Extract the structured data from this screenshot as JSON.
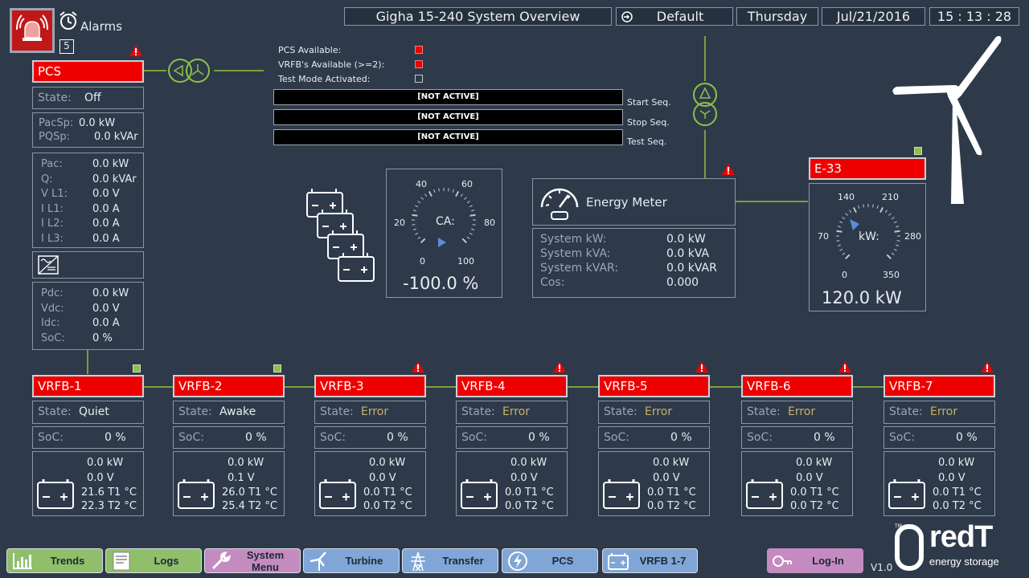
{
  "header": {
    "alarms_label": "Alarms",
    "alarm_count": "5",
    "title": "Gigha 15-240 System Overview",
    "profile": "Default",
    "day": "Thursday",
    "date": "Jul/21/2016",
    "time": "15 : 13 : 28"
  },
  "pcs": {
    "name": "PCS",
    "state_label": "State:",
    "state": "Off",
    "pacsp_label": "PacSp:",
    "pacsp": "0.0  kW",
    "pqsp_label": "PQSp:",
    "pqsp": "0.0  kVAr",
    "ac": [
      {
        "label": "Pac:",
        "value": "0.0  kW"
      },
      {
        "label": "Q:",
        "value": "0.0  kVAr"
      },
      {
        "label": "V L1:",
        "value": "0.0  V"
      },
      {
        "label": "I L1:",
        "value": "0.0  A"
      },
      {
        "label": "I L2:",
        "value": "0.0  A"
      },
      {
        "label": "I L3:",
        "value": "0.0  A"
      }
    ],
    "dc": [
      {
        "label": "Pdc:",
        "value": "0.0  kW"
      },
      {
        "label": "Vdc:",
        "value": "0.0  V"
      },
      {
        "label": "Idc:",
        "value": "0.0  A"
      },
      {
        "label": "SoC:",
        "value": "0  %"
      }
    ]
  },
  "status": {
    "pcs_available": "PCS Available:",
    "vrfb_available": "VRFB's Available (>=2):",
    "test_mode": "Test Mode Activated:",
    "colors": {
      "active": "#ee0000",
      "inactive": "#2e3a4a"
    }
  },
  "sequences": [
    {
      "status": "[NOT ACTIVE]",
      "label": "Start Seq."
    },
    {
      "status": "[NOT ACTIVE]",
      "label": "Stop Seq."
    },
    {
      "status": "[NOT ACTIVE]",
      "label": "Test Seq."
    }
  ],
  "ca_gauge": {
    "label": "CA:",
    "ticks": [
      "0",
      "20",
      "40",
      "60",
      "80",
      "100"
    ],
    "value": "-100.0  %"
  },
  "energy_meter": {
    "title": "Energy Meter",
    "rows": [
      {
        "label": "System kW:",
        "value": "0.0  kW"
      },
      {
        "label": "System kVA:",
        "value": "0.0  kVA"
      },
      {
        "label": "System kVAR:",
        "value": "0.0  kVAR"
      },
      {
        "label": "Cos:",
        "value": "0.000"
      }
    ]
  },
  "turbine": {
    "name": "E-33",
    "gauge_label": "kW:",
    "ticks": [
      "0",
      "70",
      "140",
      "210",
      "280",
      "350"
    ],
    "value": "120.0  kW"
  },
  "vrfbs": [
    {
      "name": "VRFB-1",
      "state": "Quiet",
      "error": false,
      "soc": "0  %",
      "kw": "0.0  kW",
      "v": "0.0  V",
      "t1": "21.6  T1 °C",
      "t2": "22.3  T2 °C",
      "indicator": "ok"
    },
    {
      "name": "VRFB-2",
      "state": "Awake",
      "error": false,
      "soc": "0  %",
      "kw": "0.0  kW",
      "v": "0.1  V",
      "t1": "26.0  T1 °C",
      "t2": "25.4  T2 °C",
      "indicator": "ok"
    },
    {
      "name": "VRFB-3",
      "state": "Error",
      "error": true,
      "soc": "0  %",
      "kw": "0.0  kW",
      "v": "0.0  V",
      "t1": "0.0  T1 °C",
      "t2": "0.0  T2 °C",
      "indicator": "warn"
    },
    {
      "name": "VRFB-4",
      "state": "Error",
      "error": true,
      "soc": "0  %",
      "kw": "0.0  kW",
      "v": "0.0  V",
      "t1": "0.0  T1 °C",
      "t2": "0.0  T2 °C",
      "indicator": "warn"
    },
    {
      "name": "VRFB-5",
      "state": "Error",
      "error": true,
      "soc": "0  %",
      "kw": "0.0  kW",
      "v": "0.0  V",
      "t1": "0.0  T1 °C",
      "t2": "0.0  T2 °C",
      "indicator": "warn"
    },
    {
      "name": "VRFB-6",
      "state": "Error",
      "error": true,
      "soc": "0  %",
      "kw": "0.0  kW",
      "v": "0.0  V",
      "t1": "0.0  T1 °C",
      "t2": "0.0  T2 °C",
      "indicator": "warn"
    },
    {
      "name": "VRFB-7",
      "state": "Error",
      "error": true,
      "soc": "0  %",
      "kw": "0.0  kW",
      "v": "0.0  V",
      "t1": "0.0  T1 °C",
      "t2": "0.0  T2 °C",
      "indicator": "warn"
    }
  ],
  "vrfb_labels": {
    "state": "State:",
    "soc": "SoC:"
  },
  "nav": [
    {
      "label": "Trends",
      "icon": "chart-icon",
      "color": "#8fbf6a"
    },
    {
      "label": "Logs",
      "icon": "log-icon",
      "color": "#8fbf6a"
    },
    {
      "label": "System Menu",
      "icon": "wrench-icon",
      "color": "#c48bc0"
    },
    {
      "label": "Turbine",
      "icon": "turbine-icon",
      "color": "#7fa6d6"
    },
    {
      "label": "Transfer",
      "icon": "pylon-icon",
      "color": "#7fa6d6"
    },
    {
      "label": "PCS",
      "icon": "bolt-icon",
      "color": "#7fa6d6"
    },
    {
      "label": "VRFB 1-7",
      "icon": "battery-icon",
      "color": "#7fa6d6"
    }
  ],
  "login": {
    "label": "Log-In",
    "color": "#c48bc0"
  },
  "brand": {
    "line1": "redT",
    "line2": "energy storage",
    "tm": "TM",
    "version": "V1.0"
  }
}
